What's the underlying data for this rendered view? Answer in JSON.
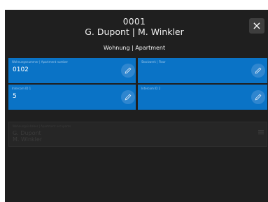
{
  "header": {
    "id": "0001",
    "names": "G. Dupont | M. Winkler",
    "subtitle": "Wohnung | Apartment",
    "close_icon": "×"
  },
  "fields": [
    {
      "label": "Wohnungsnummer | Apartment number",
      "value": "0102"
    },
    {
      "label": "Stockwerk | Floor",
      "value": ""
    },
    {
      "label": "Intercom ID 1",
      "value": "5"
    },
    {
      "label": "Intercom ID 2",
      "value": ""
    }
  ],
  "residents_field": {
    "label": "Wohnungsinhaber | Apartment occupants",
    "line1": "G. Dupont",
    "line2": "M. Winkler"
  },
  "colors": {
    "modal_bg": "#1f1f1f",
    "card_blue": "#0a73c6",
    "edit_button": "#2f86cf",
    "disabled_card": "#262626"
  },
  "icons": {
    "edit": "pencil-icon",
    "close": "close-icon",
    "disabled_edit": "list-icon"
  }
}
